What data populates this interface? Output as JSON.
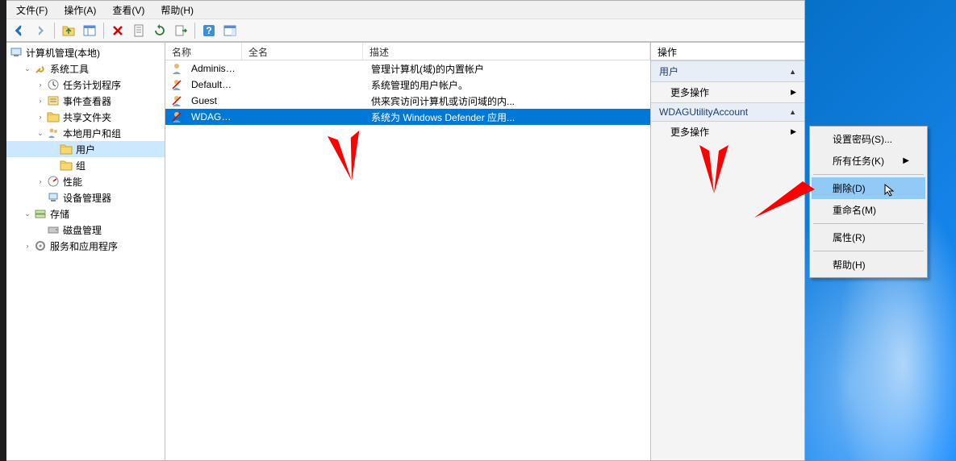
{
  "menu": {
    "file": "文件(F)",
    "action": "操作(A)",
    "view": "查看(V)",
    "help": "帮助(H)"
  },
  "tree": {
    "root": "计算机管理(本地)",
    "system_tools": "系统工具",
    "task_scheduler": "任务计划程序",
    "event_viewer": "事件查看器",
    "shared_folders": "共享文件夹",
    "local_users_groups": "本地用户和组",
    "users": "用户",
    "groups": "组",
    "performance": "性能",
    "device_manager": "设备管理器",
    "storage": "存储",
    "disk_management": "磁盘管理",
    "services_apps": "服务和应用程序"
  },
  "list": {
    "headers": {
      "name": "名称",
      "fullname": "全名",
      "description": "描述"
    },
    "rows": [
      {
        "name": "Administrat...",
        "fullname": "",
        "desc": "管理计算机(域)的内置帐户",
        "disabled": false,
        "selected": false
      },
      {
        "name": "DefaultAcc...",
        "fullname": "",
        "desc": "系统管理的用户帐户。",
        "disabled": true,
        "selected": false
      },
      {
        "name": "Guest",
        "fullname": "",
        "desc": "供来宾访问计算机或访问域的内...",
        "disabled": true,
        "selected": false
      },
      {
        "name": "WDAGUtilit...",
        "fullname": "",
        "desc": "系统为 Windows Defender 应用...",
        "disabled": true,
        "selected": true
      }
    ]
  },
  "actions": {
    "title": "操作",
    "section1_title": "用户",
    "more1": "更多操作",
    "section2_title": "WDAGUtilityAccount",
    "more2": "更多操作"
  },
  "context_menu": {
    "set_password": "设置密码(S)...",
    "all_tasks": "所有任务(K)",
    "delete": "删除(D)",
    "rename": "重命名(M)",
    "properties": "属性(R)",
    "help": "帮助(H)"
  },
  "col_widths": {
    "name": "95px",
    "fullname": "150px",
    "desc": "auto"
  }
}
